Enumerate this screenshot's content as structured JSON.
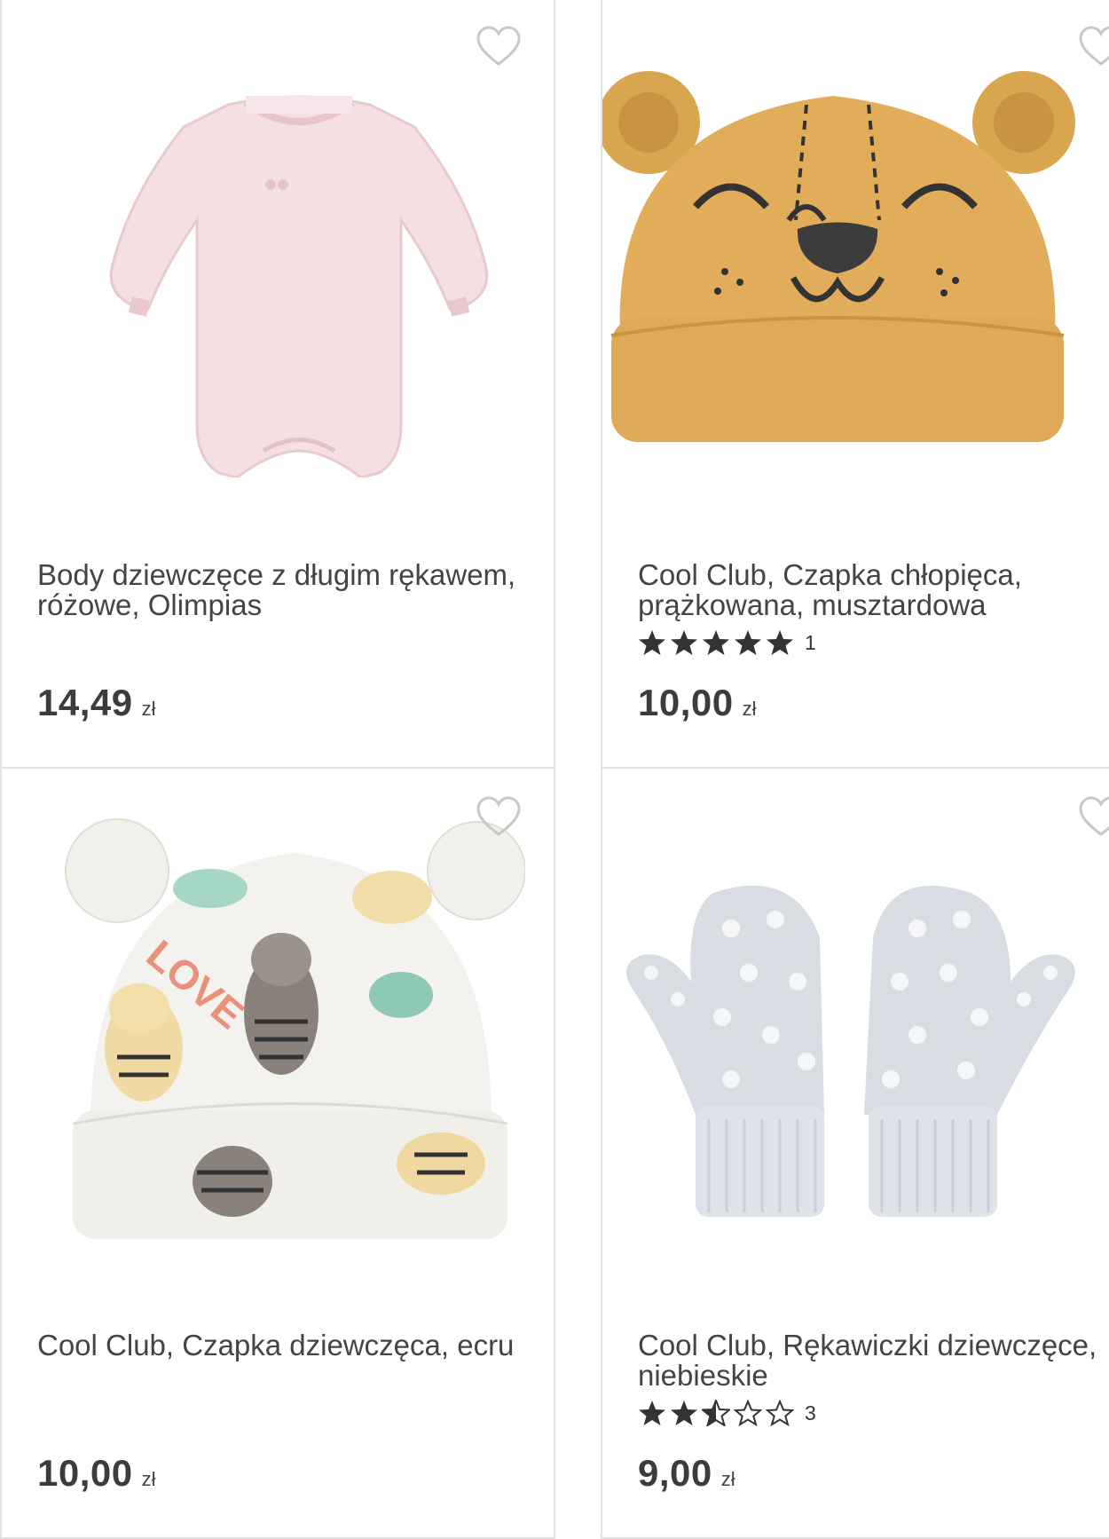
{
  "products": [
    {
      "title": "Body dziewczęce z długim rękawem, różowe, Olimpias",
      "price": "14,49",
      "currency": "zł",
      "rating": null,
      "image_icon": "pink-bodysuit"
    },
    {
      "title": "Cool Club, Czapka chłopięca, prążkowana, musztardowa",
      "price": "10,00",
      "currency": "zł",
      "rating": {
        "value": 5,
        "count": "1"
      },
      "image_icon": "mustard-bear-hat"
    },
    {
      "title": "Cool Club, Czapka dziewczęca, ecru",
      "price": "10,00",
      "currency": "zł",
      "rating": null,
      "image_icon": "ecru-tiger-hat"
    },
    {
      "title": "Cool Club, Rękawiczki dziewczęce, niebieskie",
      "price": "9,00",
      "currency": "zł",
      "rating": {
        "value": 2.5,
        "count": "3"
      },
      "image_icon": "blue-mittens"
    }
  ],
  "icons": {
    "favorite": "heart-outline-icon",
    "star_full": "star-filled-icon",
    "star_half": "star-half-icon",
    "star_empty": "star-outline-icon"
  },
  "colors": {
    "text": "#444444",
    "border": "#e2e2e2",
    "star": "#333333",
    "heart": "#c8c8c8"
  }
}
